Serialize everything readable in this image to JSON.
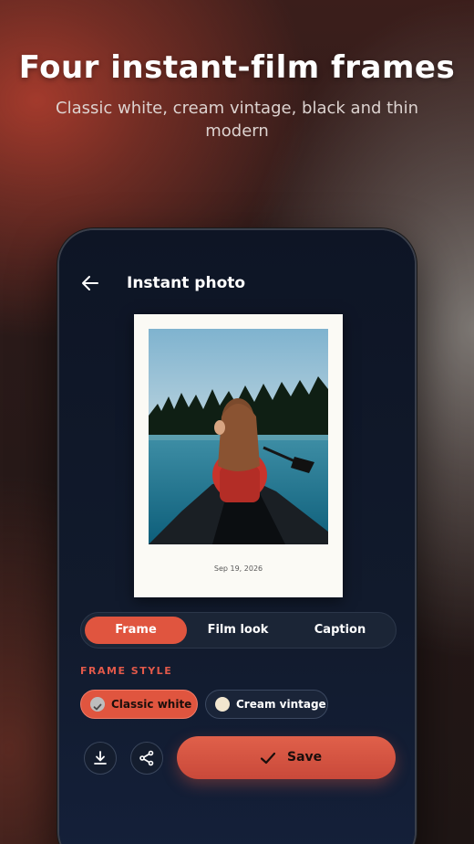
{
  "promo": {
    "headline": "Four instant-film frames",
    "subline": "Classic white, cream vintage, black and thin modern"
  },
  "screen": {
    "title": "Instant photo",
    "back_icon": "arrow-left-icon"
  },
  "polaroid": {
    "date": "Sep 19, 2026",
    "frame_color": "#fbfaf5"
  },
  "tabs": [
    {
      "label": "Frame",
      "active": true
    },
    {
      "label": "Film look",
      "active": false
    },
    {
      "label": "Caption",
      "active": false
    }
  ],
  "frame_style": {
    "label": "FRAME STYLE",
    "options": [
      {
        "label": "Classic white",
        "selected": true,
        "swatch": "#bdbdbd"
      },
      {
        "label": "Cream vintage",
        "selected": false,
        "swatch": "#f2e6cf"
      }
    ]
  },
  "actions": {
    "download_icon": "download-icon",
    "share_icon": "share-icon",
    "save_label": "Save",
    "save_icon": "check-icon"
  },
  "colors": {
    "accent": "#e0553f",
    "screen_bg": "#0e1525"
  }
}
